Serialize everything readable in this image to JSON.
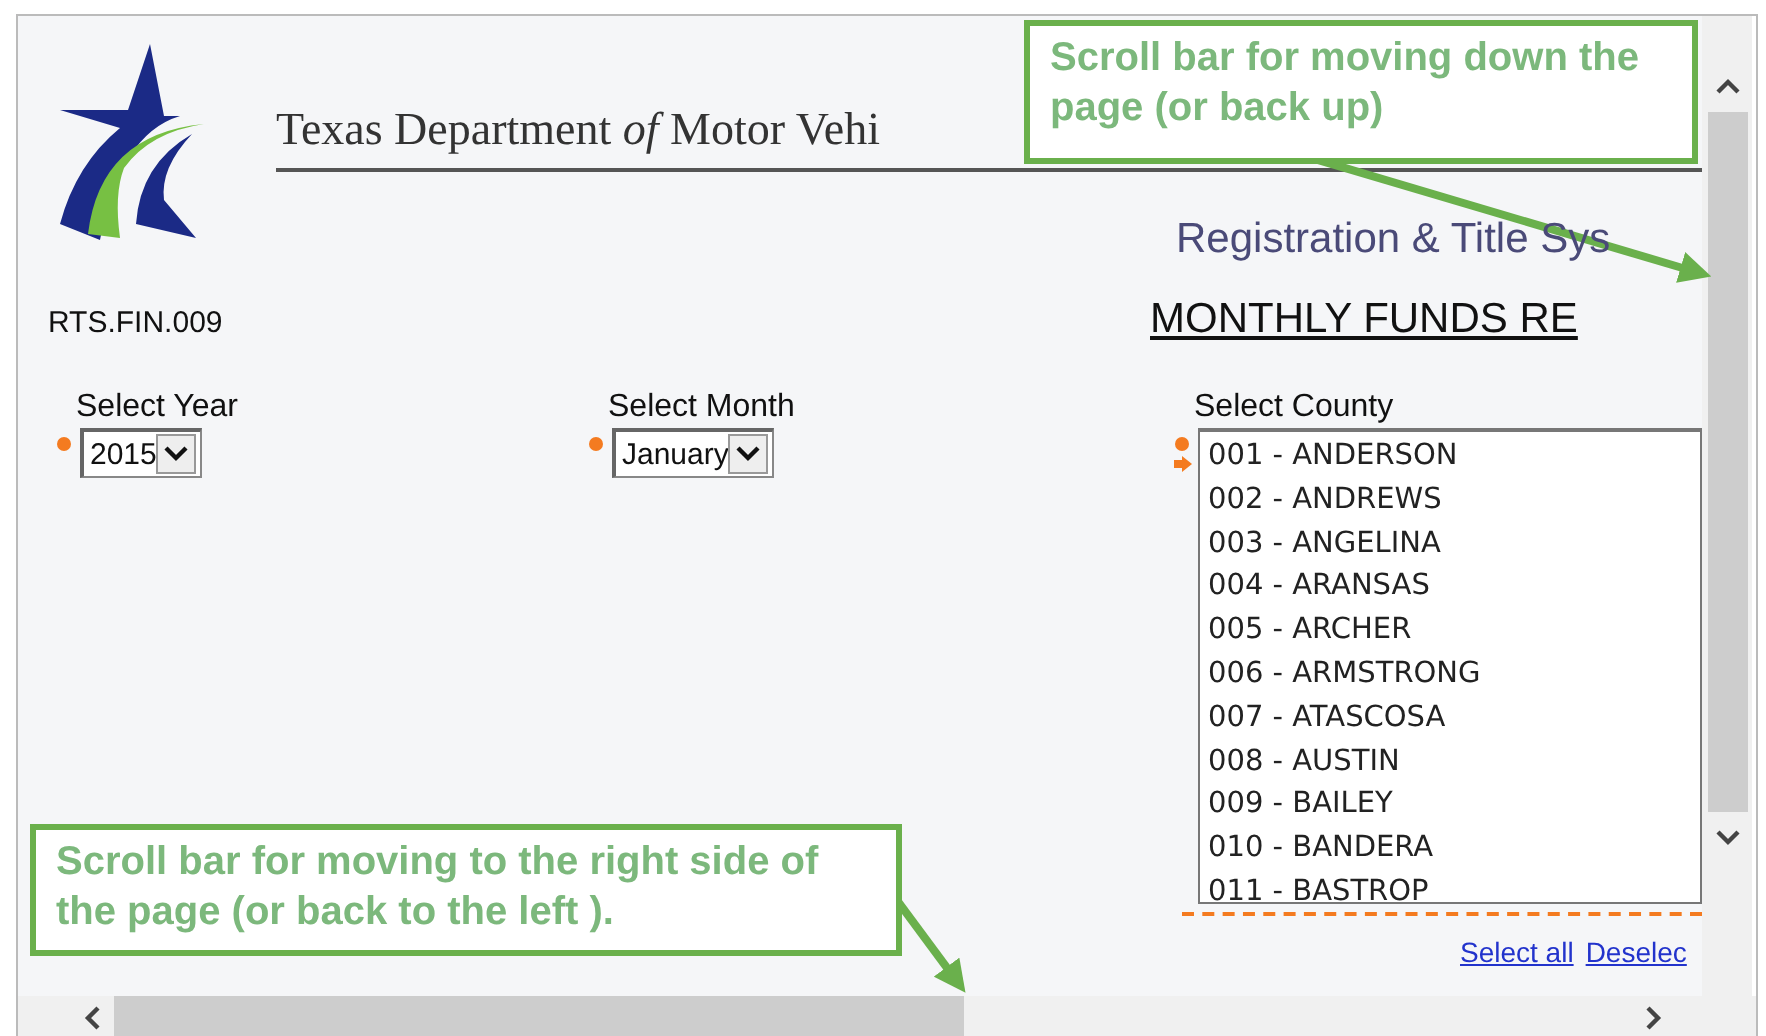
{
  "header": {
    "agency": "Texas Department *of* Motor Vehi",
    "system": "Registration & Title Sys"
  },
  "report": {
    "code": "RTS.FIN.009",
    "title": "MONTHLY FUNDS RE"
  },
  "fields": [
    {
      "kind": "dropdown",
      "label": "Select Year",
      "value": "2015",
      "required": true
    },
    {
      "kind": "dropdown",
      "label": "Select Month",
      "value": "January",
      "required": true
    },
    {
      "kind": "listbox",
      "label": "Select County",
      "required": true,
      "options": [
        "001 - ANDERSON",
        "002 - ANDREWS",
        "003 - ANGELINA",
        "004 - ARANSAS",
        "005 - ARCHER",
        "006 - ARMSTRONG",
        "007 - ATASCOSA",
        "008 - AUSTIN",
        "009 - BAILEY",
        "010 - BANDERA",
        "011 - BASTROP"
      ]
    }
  ],
  "links": [
    "Select all",
    "Deselec"
  ],
  "callouts": [
    {
      "kind": "vertical",
      "text": "Scroll bar for moving down the page (or back up)"
    },
    {
      "kind": "horizontal",
      "text": "Scroll bar for moving to the right side of the page (or back to the left )."
    }
  ]
}
